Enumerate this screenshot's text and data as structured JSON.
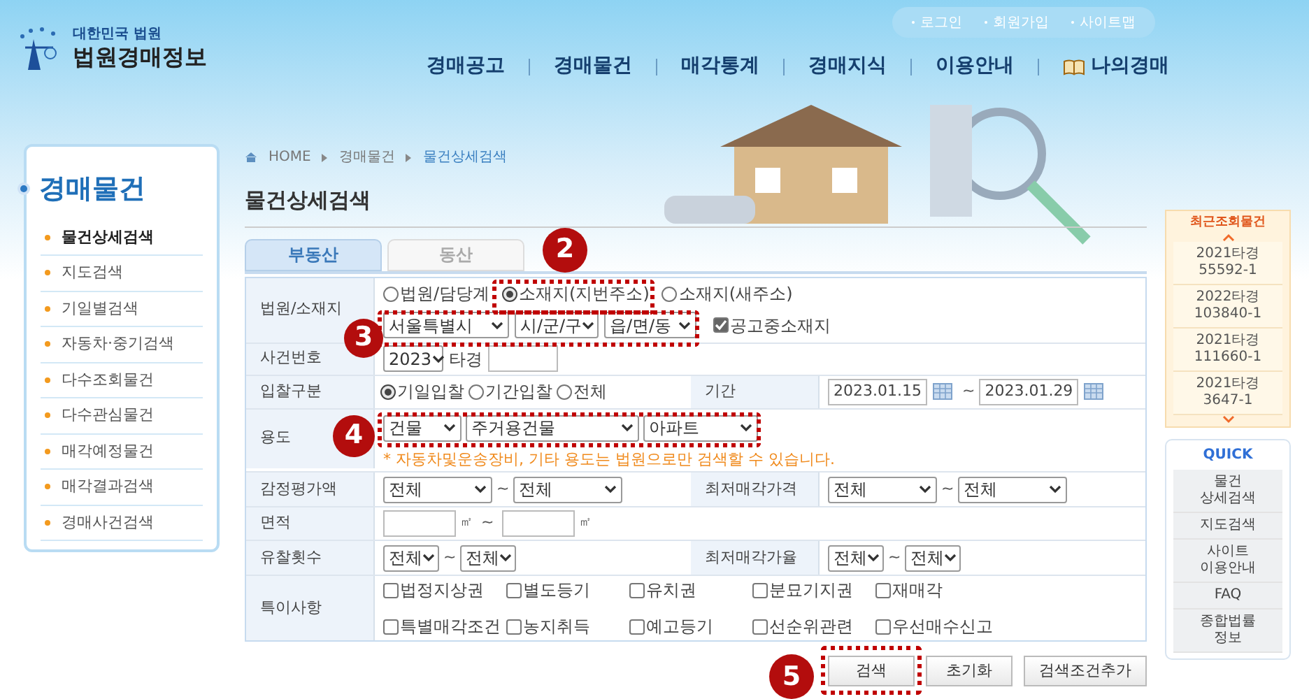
{
  "header": {
    "logo_top": "대한민국 법원",
    "logo_name": "법원경매정보",
    "util_links": [
      "로그인",
      "회원가입",
      "사이트맵"
    ],
    "nav": [
      {
        "label": "경매공고",
        "kind": "text"
      },
      {
        "label": "경매물건",
        "kind": "text"
      },
      {
        "label": "매각통계",
        "kind": "text"
      },
      {
        "label": "경매지식",
        "kind": "text"
      },
      {
        "label": "이용안내",
        "kind": "text"
      },
      {
        "label": "나의경매",
        "kind": "book"
      }
    ]
  },
  "sidebar": {
    "title": "경매물건",
    "items": [
      {
        "label": "물건상세검색",
        "selected": true
      },
      {
        "label": "지도검색",
        "selected": false
      },
      {
        "label": "기일별검색",
        "selected": false
      },
      {
        "label": "자동차·중기검색",
        "selected": false
      },
      {
        "label": "다수조회물건",
        "selected": false
      },
      {
        "label": "다수관심물건",
        "selected": false
      },
      {
        "label": "매각예정물건",
        "selected": false
      },
      {
        "label": "매각결과검색",
        "selected": false
      },
      {
        "label": "경매사건검색",
        "selected": false
      }
    ]
  },
  "breadcrumb": [
    "HOME",
    "경매물건",
    "물건상세검색"
  ],
  "page_title": "물건상세검색",
  "tabs": [
    {
      "label": "부동산",
      "selected": true
    },
    {
      "label": "동산",
      "selected": false
    }
  ],
  "form": {
    "court_location": {
      "label": "법원/소재지",
      "radios": [
        {
          "label": "법원/담당계",
          "selected": false
        },
        {
          "label": "소재지(지번주소)",
          "selected": true
        },
        {
          "label": "소재지(새주소)",
          "selected": false
        }
      ],
      "selects": [
        "서울특별시",
        "시/군/구",
        "읍/면/동"
      ],
      "checkbox": {
        "label": "공고중소재지",
        "checked": true
      }
    },
    "case_number": {
      "label": "사건번호",
      "year": "2023",
      "suffix": "타경"
    },
    "bid_type": {
      "label": "입찰구분",
      "radios": [
        {
          "label": "기일입찰",
          "selected": true
        },
        {
          "label": "기간입찰",
          "selected": false
        },
        {
          "label": "전체",
          "selected": false
        }
      ],
      "period_label": "기간",
      "from": "2023.01.15",
      "sep": "~",
      "to": "2023.01.29"
    },
    "usage": {
      "label": "용도",
      "selects": [
        "건물",
        "주거용건물",
        "아파트"
      ],
      "note": "* 자동차및운송장비, 기타 용도는 법원으로만 검색할 수 있습니다."
    },
    "appraisal": {
      "label": "감정평가액",
      "from": "전체",
      "sep": "~",
      "to": "전체",
      "min_label": "최저매각가격",
      "min_from": "전체",
      "min_sep": "~",
      "min_to": "전체"
    },
    "area": {
      "label": "면적",
      "unit1": "㎡",
      "sep": "~",
      "unit2": "㎡"
    },
    "fail_count": {
      "label": "유찰횟수",
      "from": "전체",
      "sep": "~",
      "to": "전체",
      "min_label": "최저매각가율",
      "min_from": "전체",
      "min_sep": "~",
      "min_to": "전체"
    },
    "special": {
      "label": "특이사항",
      "options": [
        {
          "label": "법정지상권",
          "checked": false
        },
        {
          "label": "별도등기",
          "checked": false
        },
        {
          "label": "유치권",
          "checked": false
        },
        {
          "label": "분묘기지권",
          "checked": false
        },
        {
          "label": "재매각",
          "checked": false
        },
        {
          "label": "특별매각조건",
          "checked": false
        },
        {
          "label": "농지취득",
          "checked": false
        },
        {
          "label": "예고등기",
          "checked": false
        },
        {
          "label": "선순위관련",
          "checked": false
        },
        {
          "label": "우선매수신고",
          "checked": false
        }
      ]
    }
  },
  "buttons": [
    "검색",
    "초기화",
    "검색조건추가"
  ],
  "annotations": [
    "2",
    "3",
    "4",
    "5"
  ],
  "recent": {
    "title": "최근조회물건",
    "items": [
      [
        "2021타경",
        "55592-1"
      ],
      [
        "2022타경",
        "103840-1"
      ],
      [
        "2021타경",
        "111660-1"
      ],
      [
        "2021타경",
        "3647-1"
      ]
    ]
  },
  "quick": {
    "title": "QUICK",
    "items": [
      [
        "물건",
        "상세검색"
      ],
      [
        "지도검색"
      ],
      [
        "사이트",
        "이용안내"
      ],
      [
        "FAQ"
      ],
      [
        "종합법률",
        "정보"
      ]
    ]
  }
}
